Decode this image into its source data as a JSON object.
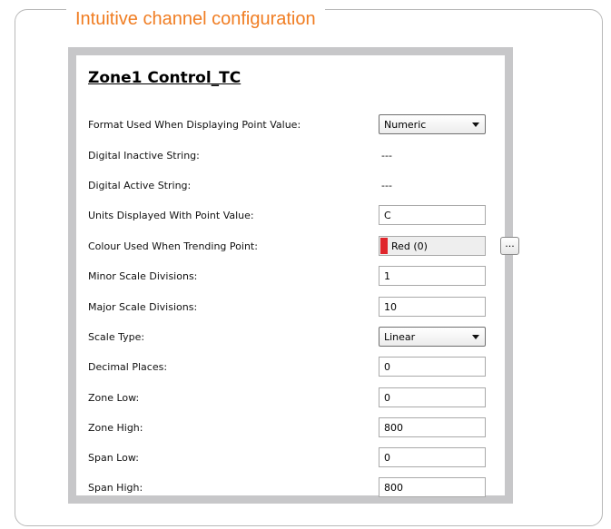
{
  "frame": {
    "title": "Intuitive channel configuration",
    "title_color": "#f07d22"
  },
  "panel": {
    "title": "Zone1 Control_TC"
  },
  "rows": [
    {
      "label": "Format Used When Displaying Point Value:",
      "kind": "select",
      "value": "Numeric"
    },
    {
      "label": "Digital Inactive String:",
      "kind": "plain",
      "value": "---"
    },
    {
      "label": "Digital Active String:",
      "kind": "plain",
      "value": "---"
    },
    {
      "label": "Units Displayed With Point Value:",
      "kind": "input",
      "value": "C"
    },
    {
      "label": "Colour Used When Trending Point:",
      "kind": "colour",
      "value": "Red (0)",
      "swatch": "#e0252b",
      "button": "..."
    },
    {
      "label": "Minor Scale Divisions:",
      "kind": "input",
      "value": "1"
    },
    {
      "label": "Major Scale Divisions:",
      "kind": "input",
      "value": "10"
    },
    {
      "label": "Scale Type:",
      "kind": "select",
      "value": "Linear"
    },
    {
      "label": "Decimal Places:",
      "kind": "input",
      "value": "0"
    },
    {
      "label": "Zone Low:",
      "kind": "input",
      "value": "0"
    },
    {
      "label": "Zone High:",
      "kind": "input",
      "value": "800"
    },
    {
      "label": "Span Low:",
      "kind": "input",
      "value": "0"
    },
    {
      "label": "Span High:",
      "kind": "input",
      "value": "800"
    }
  ]
}
